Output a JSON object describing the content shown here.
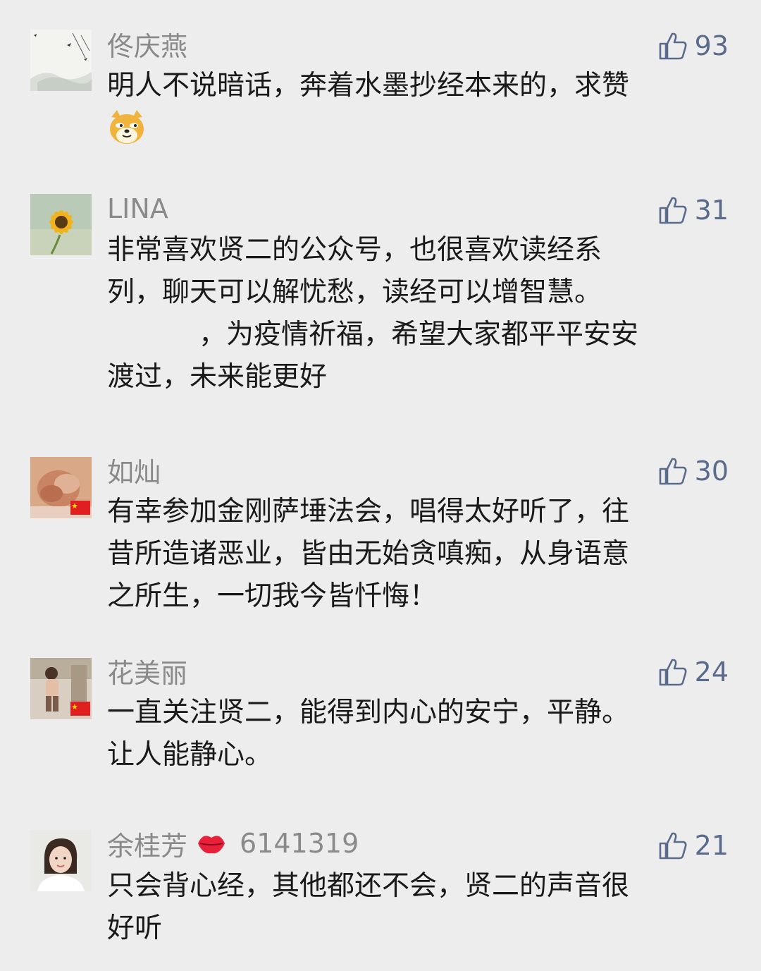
{
  "comments": [
    {
      "name": "佟庆燕",
      "likes": "93",
      "lines": [
        "明人不说暗话，奔着水墨抄经本来的，求赞"
      ],
      "trailing_emoji": "doge-emoji",
      "avatar": "ink-painting-avatar"
    },
    {
      "name": "LINA",
      "likes": "31",
      "lines": [
        "非常喜欢贤二的公众号，也很喜欢读经系",
        "列，聊天可以解忧愁，读经可以增智慧。",
        "，为疫情祈福，希望大家都平平安安",
        "渡过，未来能更好"
      ],
      "avatar": "sunflower-avatar"
    },
    {
      "name": "如灿",
      "likes": "30",
      "lines": [
        "有幸参加金刚萨埵法会，唱得太好听了，往",
        "昔所造诸恶业，皆由无始贪嗔痴，从身语意",
        "之所生，一切我今皆忏悔！"
      ],
      "avatar": "hands-avatar",
      "flag": "china-flag"
    },
    {
      "name": "花美丽",
      "likes": "24",
      "lines": [
        "一直关注贤二，能得到内心的安宁，平静。",
        "让人能静心。"
      ],
      "avatar": "child-avatar",
      "flag": "china-flag"
    },
    {
      "name": "余桂芳",
      "name_suffix": "6141319",
      "name_emoji": "lips-emoji",
      "likes": "21",
      "lines": [
        "只会背心经，其他都还不会，贤二的声音很",
        "好听"
      ],
      "avatar": "woman-portrait-avatar"
    }
  ],
  "colors": {
    "background": "#ededed",
    "nickname": "#8a8a8a",
    "like": "#5b6b8c",
    "text": "#1a1a1a"
  }
}
